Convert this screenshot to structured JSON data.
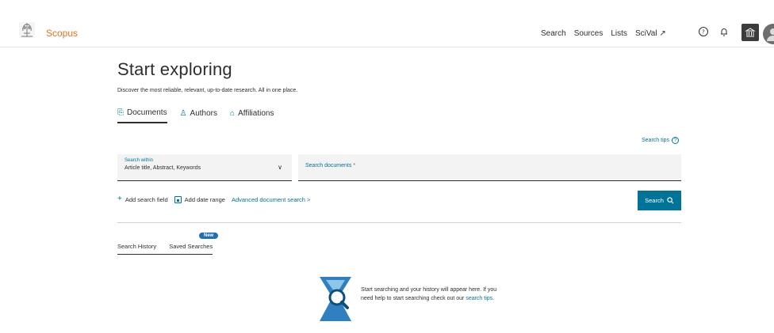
{
  "header": {
    "brand": "Scopus",
    "nav": [
      "Search",
      "Sources",
      "Lists",
      "SciVal ↗"
    ],
    "icons": [
      "help-icon",
      "bell-icon",
      "institution-icon",
      "avatar"
    ]
  },
  "main": {
    "title": "Start exploring",
    "subtitle": "Discover the most reliable, relevant, up-to-date research. All in one place.",
    "tabs": [
      {
        "label": "Documents",
        "icon": "document-icon",
        "active": true
      },
      {
        "label": "Authors",
        "icon": "person-icon",
        "active": false
      },
      {
        "label": "Affiliations",
        "icon": "building-icon",
        "active": false
      }
    ],
    "search_tips": "Search tips",
    "search_within": {
      "label": "Search within",
      "value": "Article title, Abstract, Keywords"
    },
    "search_documents": {
      "label": "Search documents",
      "required_mark": "*"
    },
    "actions": {
      "add_field": "Add search field",
      "add_date": "Add date range",
      "advanced": "Advanced document search >"
    },
    "search_button": "Search",
    "history_tabs": [
      "Search History",
      "Saved Searches"
    ],
    "new_badge": "New",
    "empty_state": {
      "text": "Start searching and your history will appear here. If you need help to start searching check out our",
      "link": "search tips",
      "end": "."
    }
  },
  "colors": {
    "accent": "#007398",
    "brand": "#e9711c",
    "badge": "#1f6fb2"
  }
}
